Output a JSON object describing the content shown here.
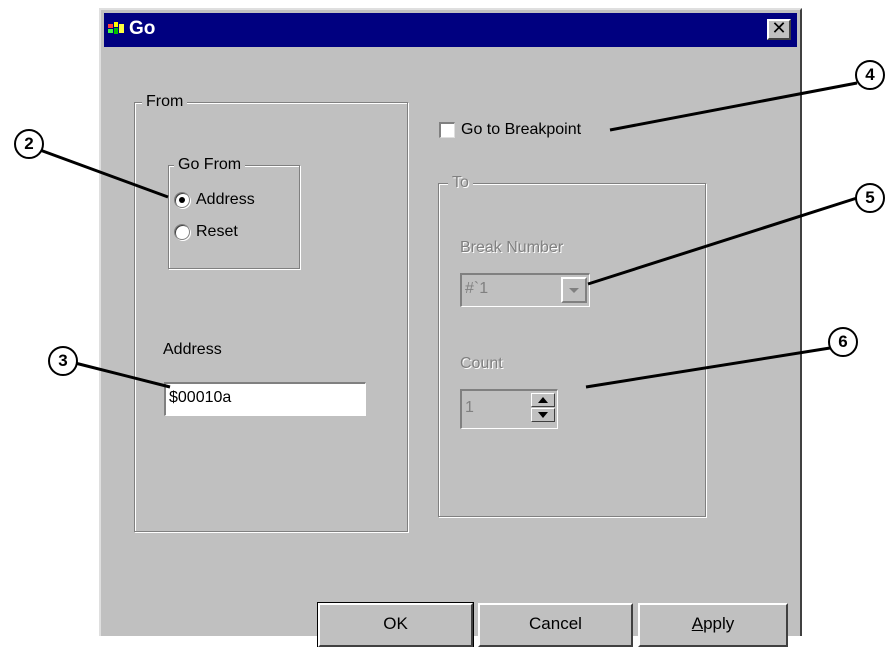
{
  "window": {
    "title": "Go",
    "close_glyph": "✕"
  },
  "from_group": {
    "legend": "From",
    "go_from": {
      "legend": "Go From",
      "options": [
        {
          "label": "Address",
          "selected": true
        },
        {
          "label": "Reset",
          "selected": false
        }
      ]
    },
    "address_label": "Address",
    "address_value": "$00010a"
  },
  "go_to_breakpoint": {
    "label": "Go to Breakpoint",
    "checked": false
  },
  "to_group": {
    "legend": "To",
    "break_number_label": "Break Number",
    "break_number_value": "#`1",
    "count_label": "Count",
    "count_value": "1"
  },
  "buttons": {
    "ok": "OK",
    "cancel": "Cancel",
    "apply_prefix": "A",
    "apply_rest": "pply"
  },
  "callouts": [
    "2",
    "3",
    "4",
    "5",
    "6"
  ],
  "colors": {
    "titlebar": "#000080",
    "face": "#c0c0c0",
    "disabled_text": "#808080"
  },
  "icons": {
    "app": "app-icon",
    "close": "close-icon",
    "dropdown": "chevron-down-icon",
    "spin_up": "spin-up-icon",
    "spin_down": "spin-down-icon"
  }
}
